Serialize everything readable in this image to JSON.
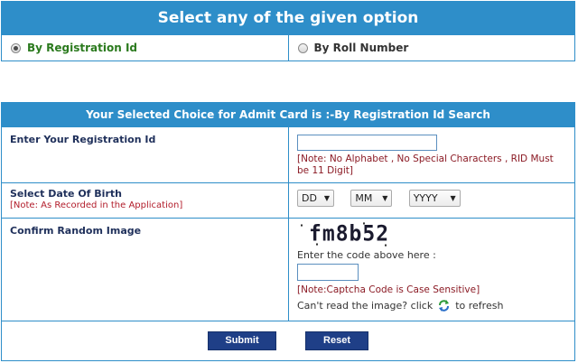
{
  "option_panel": {
    "title": "Select any of the given option",
    "options": [
      {
        "label": "By Registration Id",
        "selected": true
      },
      {
        "label": "By Roll Number",
        "selected": false
      }
    ]
  },
  "form": {
    "header": "Your Selected Choice for Admit Card is :-By Registration Id Search",
    "registration": {
      "label": "Enter Your Registration Id",
      "value": "",
      "note": "[Note: No Alphabet , No Special Characters , RID Must be 11 Digit]"
    },
    "dob": {
      "label": "Select Date Of Birth",
      "sub_note": "[Note: As Recorded in the Application]",
      "day": "DD",
      "month": "MM",
      "year": "YYYY"
    },
    "captcha": {
      "label": "Confirm Random Image",
      "image_text": "fm8b52",
      "prompt": "Enter the code above here :",
      "value": "",
      "note": "[Note:Captcha Code is Case Sensitive]",
      "refresh_prefix": "Can't read the image? click",
      "refresh_suffix": "to refresh"
    },
    "buttons": {
      "submit": "Submit",
      "reset": "Reset"
    }
  },
  "colors": {
    "panel_blue": "#2e8ec9",
    "button_navy": "#1f3f87",
    "note_red": "#8b1a24",
    "selected_green": "#2b7a1e"
  }
}
